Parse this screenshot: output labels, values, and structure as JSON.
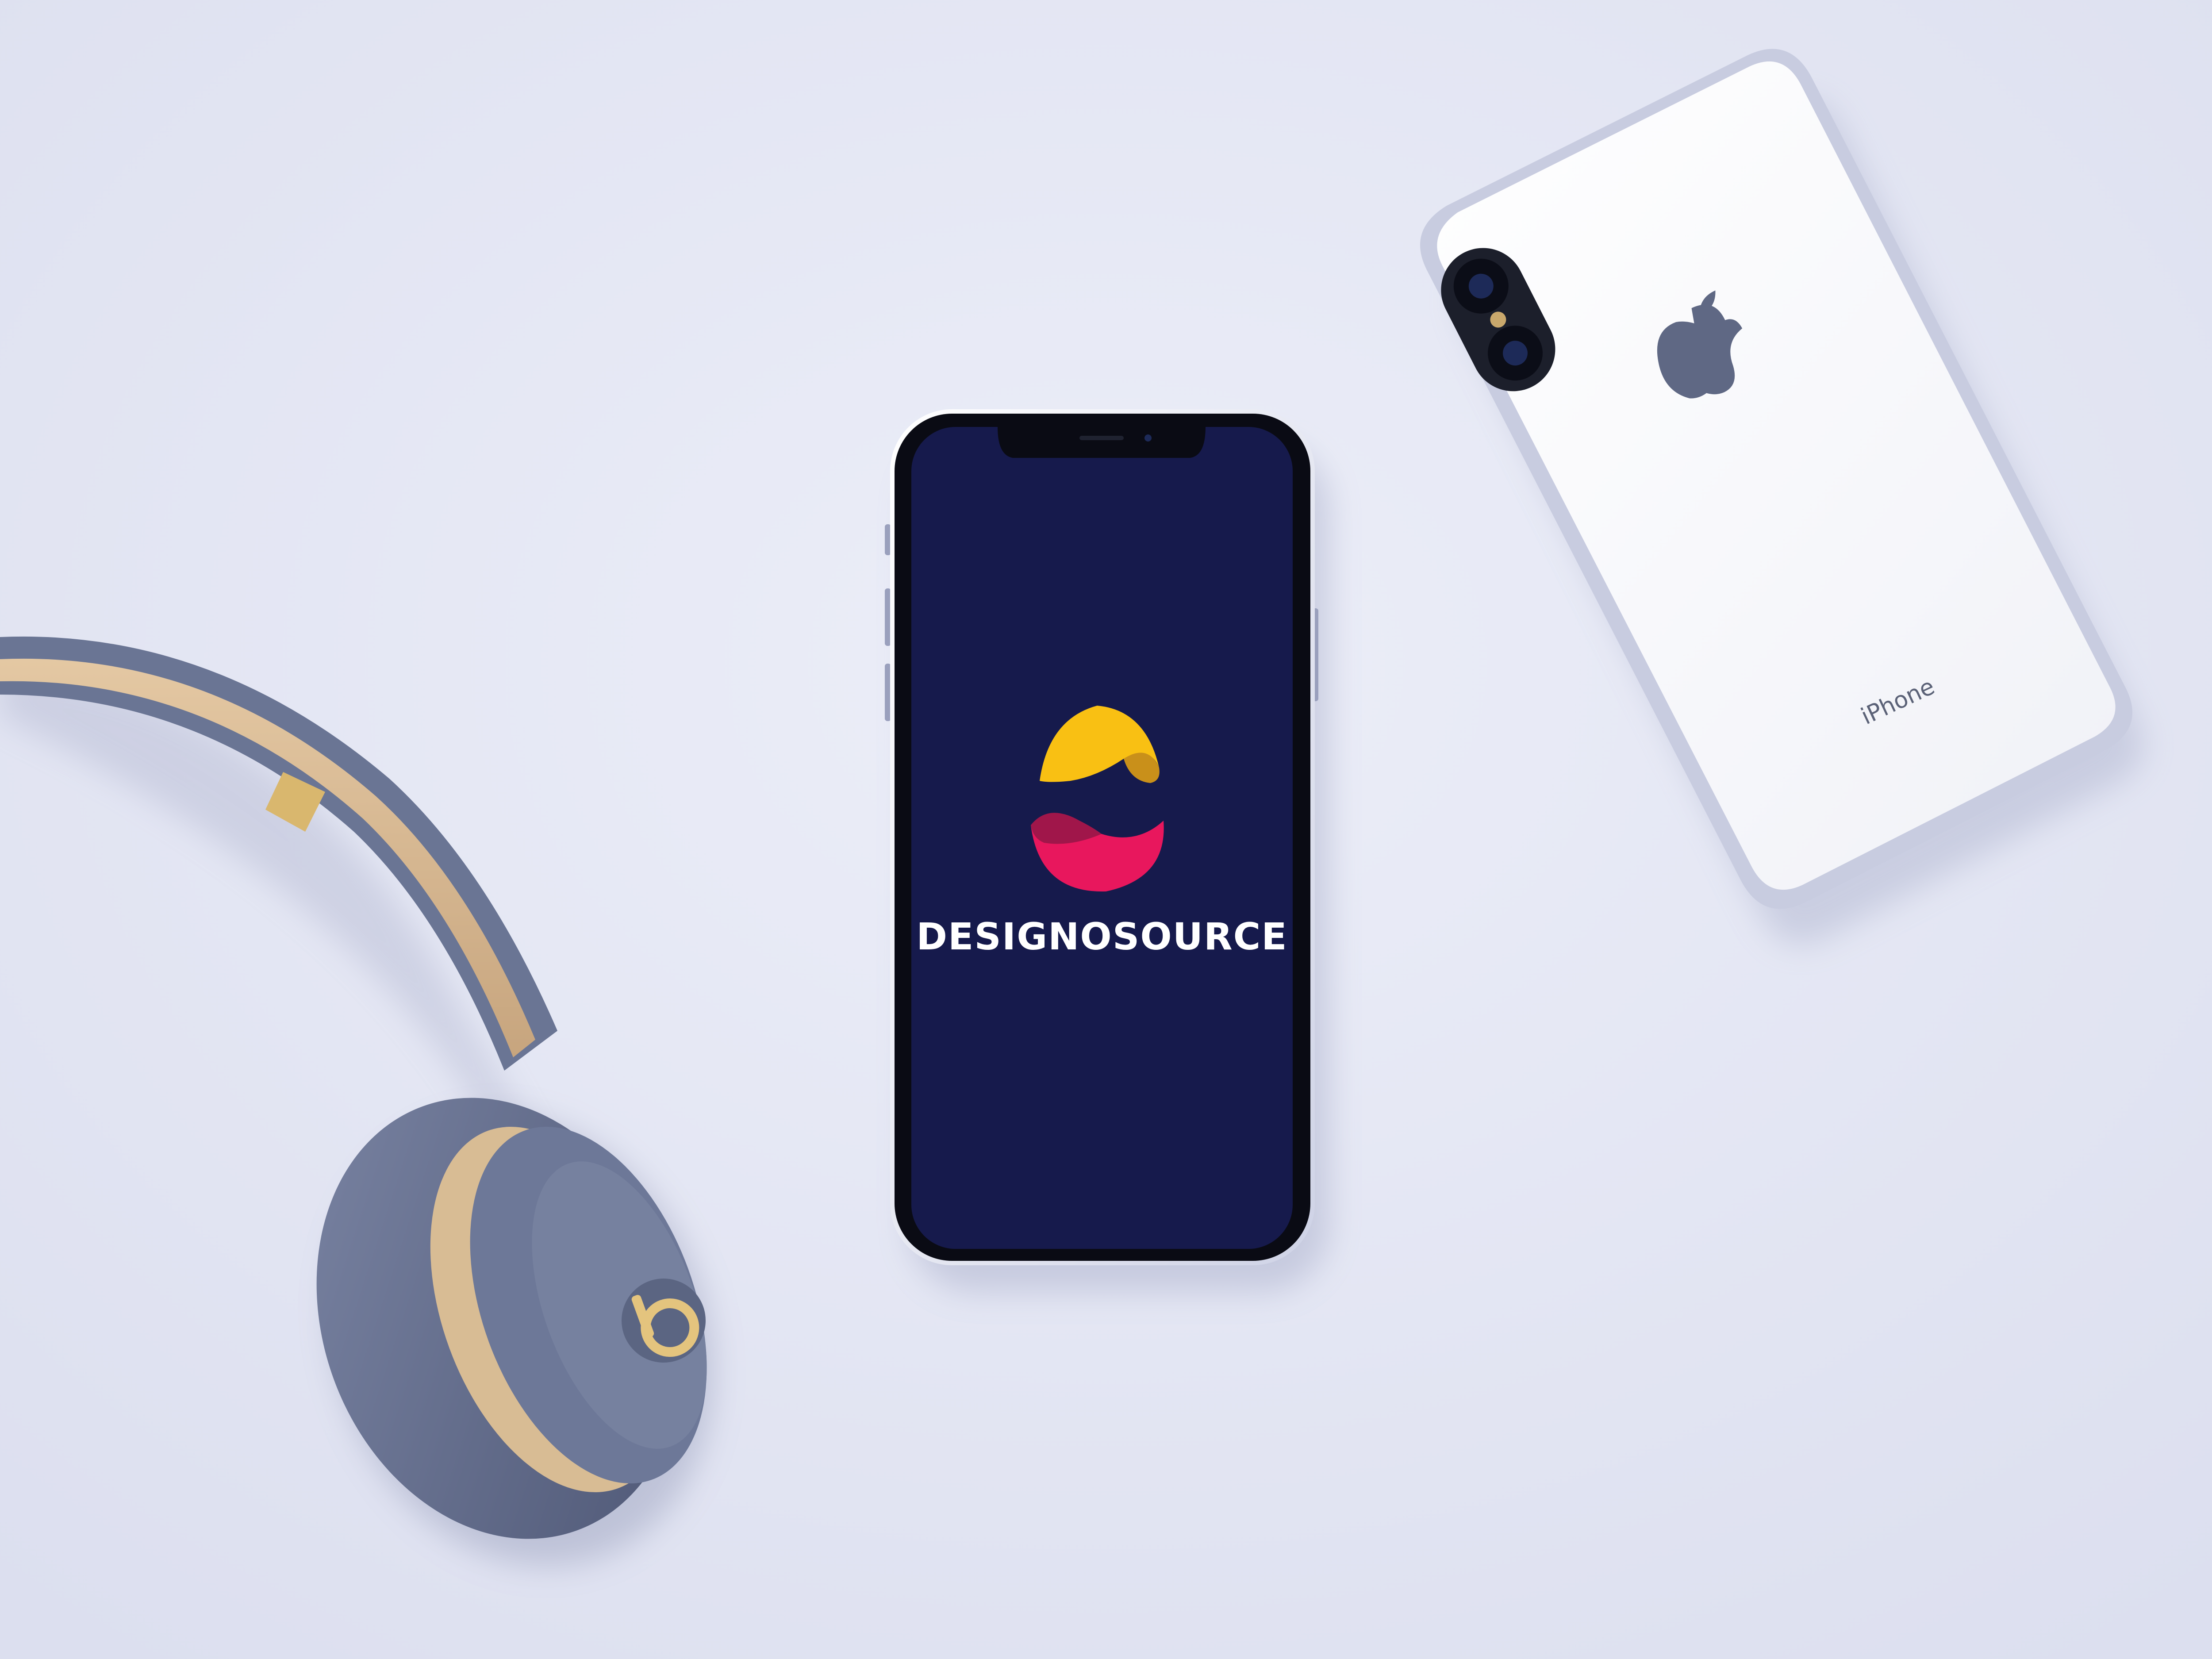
{
  "scene": {
    "background_color": "#e6e8f5",
    "accent_colors": {
      "screen_navy": "#161a4c",
      "logo_yellow": "#f9c013",
      "logo_pink": "#e8175d",
      "headphone_slate": "#65708f",
      "headphone_gold": "#d9b76e"
    }
  },
  "front_phone": {
    "brand_name": "DESIGNOSOURCE",
    "logo_icon": "designosource-logo-icon"
  },
  "back_phone": {
    "label": "iPhone",
    "logo_icon": "apple-logo-icon"
  },
  "headphones": {
    "brand_icon": "beats-b-icon"
  }
}
